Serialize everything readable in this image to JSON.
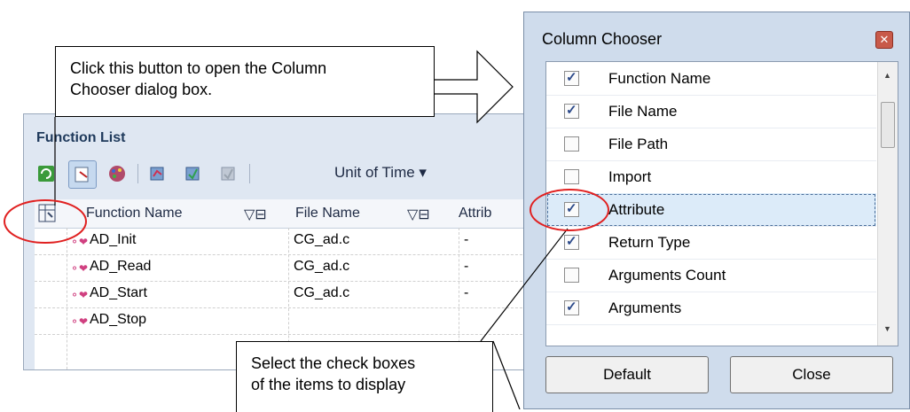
{
  "callouts": {
    "open_dialog": [
      "Click this button to open the Column",
      "Chooser dialog box."
    ],
    "select_items": [
      "Select the check boxes",
      "of the items to display"
    ]
  },
  "function_list": {
    "title": "Function List",
    "toolbar": {
      "buttons": [
        "refresh-icon",
        "column-chooser-toolbar-icon",
        "palette-icon",
        "profile-icon-1",
        "profile-icon-2",
        "profile-icon-3"
      ],
      "unit_of_time": "Unit of Time ▾"
    },
    "columns": [
      "Function Name",
      "File Name",
      "Attrib"
    ],
    "rows": [
      {
        "function": "AD_Init",
        "file": "CG_ad.c",
        "attr": "-"
      },
      {
        "function": "AD_Read",
        "file": "CG_ad.c",
        "attr": "-"
      },
      {
        "function": "AD_Start",
        "file": "CG_ad.c",
        "attr": "-"
      },
      {
        "function": "AD_Stop",
        "file": "",
        "attr": ""
      }
    ]
  },
  "column_chooser": {
    "title": "Column Chooser",
    "items": [
      {
        "label": "Function Name",
        "checked": true
      },
      {
        "label": "File Name",
        "checked": true
      },
      {
        "label": "File Path",
        "checked": false
      },
      {
        "label": "Import",
        "checked": false
      },
      {
        "label": "Attribute",
        "checked": true,
        "selected": true
      },
      {
        "label": "Return Type",
        "checked": true
      },
      {
        "label": "Arguments Count",
        "checked": false
      },
      {
        "label": "Arguments",
        "checked": true
      }
    ],
    "default_button": "Default",
    "close_button": "Close"
  },
  "colors": {
    "highlight_circle": "#e02020",
    "panel_bg": "#dfe7f2",
    "dialog_bg": "#cfdcec"
  }
}
